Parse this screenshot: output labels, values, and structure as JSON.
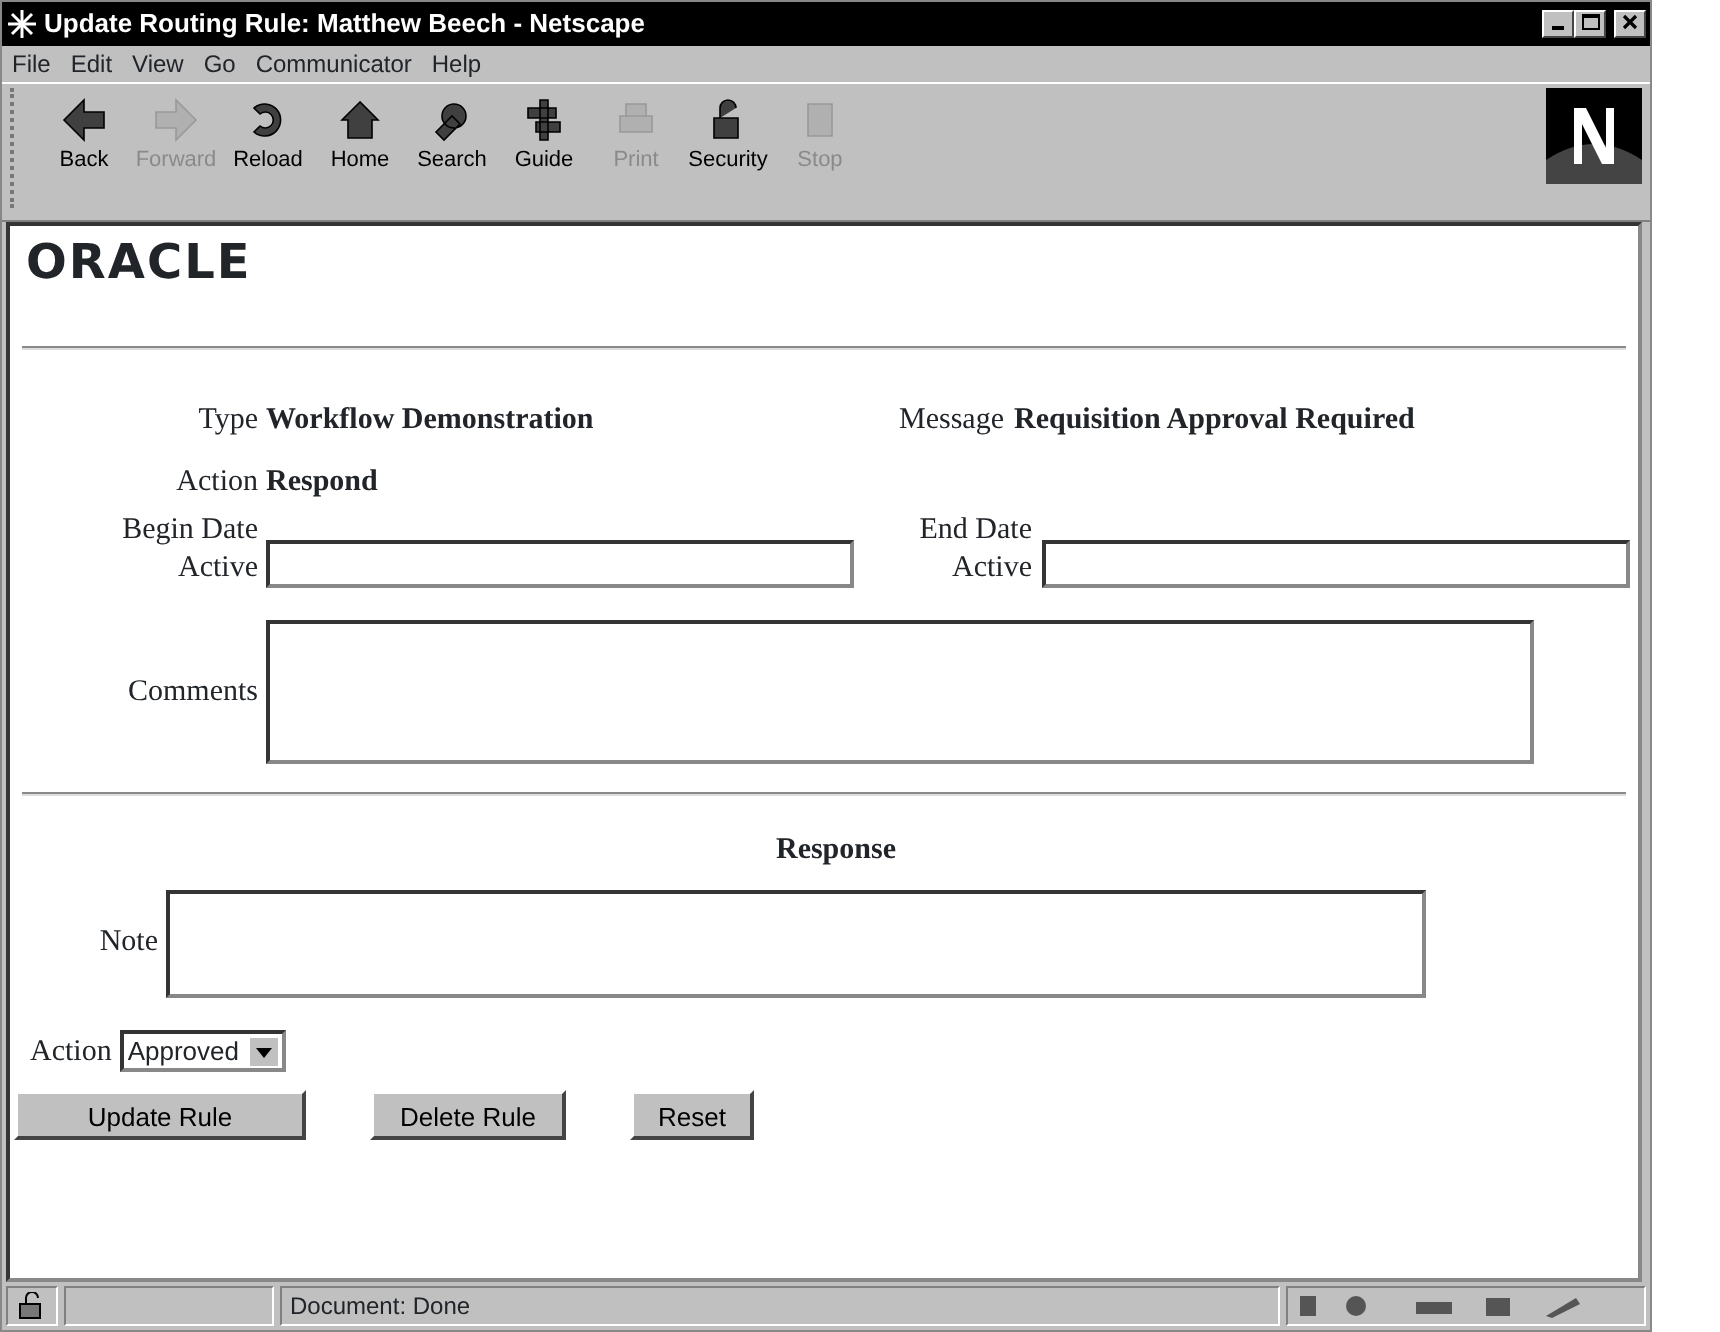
{
  "window": {
    "title": "Update Routing Rule: Matthew Beech - Netscape"
  },
  "menu": [
    "File",
    "Edit",
    "View",
    "Go",
    "Communicator",
    "Help"
  ],
  "toolbar": [
    {
      "label": "Back",
      "disabled": false
    },
    {
      "label": "Forward",
      "disabled": true
    },
    {
      "label": "Reload",
      "disabled": false
    },
    {
      "label": "Home",
      "disabled": false
    },
    {
      "label": "Search",
      "disabled": false
    },
    {
      "label": "Guide",
      "disabled": false
    },
    {
      "label": "Print",
      "disabled": true
    },
    {
      "label": "Security",
      "disabled": false
    },
    {
      "label": "Stop",
      "disabled": true
    }
  ],
  "page": {
    "logo": "ORACLE",
    "fields": [
      {
        "label": "Type",
        "value": "Workflow Demonstration"
      },
      {
        "label": "Message",
        "value": "Requisition Approval Required"
      },
      {
        "label": "Action",
        "value": "Respond"
      }
    ],
    "begin_date": {
      "label": "Begin Date Active"
    },
    "end_date": {
      "label": "End Date Active"
    },
    "comments": {
      "label": "Comments"
    },
    "response": {
      "heading": "Response",
      "note_label": "Note",
      "action_label": "Action",
      "action_value": "Approved"
    },
    "buttons": [
      "Update Rule",
      "Delete Rule",
      "Reset"
    ]
  },
  "status_bar": {
    "text": "Document: Done"
  }
}
